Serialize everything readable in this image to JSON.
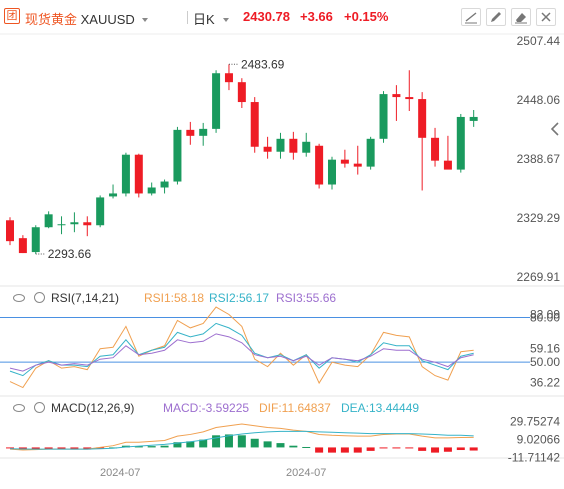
{
  "header": {
    "logo_text": "团",
    "instrument_name": "现货黄金",
    "symbol": "XAUUSD",
    "period": "日K",
    "last": "2430.78",
    "change": "+3.66",
    "change_pct": "+0.15%",
    "tools": [
      "draw-line-icon",
      "pencil-icon",
      "eraser-icon",
      "expand-icon",
      "close-icon"
    ]
  },
  "colors": {
    "up": "#1a9a5e",
    "down": "#ee1c25",
    "rsi1": "#f0a050",
    "rsi2": "#36b3c8",
    "rsi3": "#9d6fcf",
    "diff": "#f0a050",
    "dea": "#36b3c8",
    "level": "#4a90e2"
  },
  "chart_data": [
    {
      "type": "candlestick",
      "yaxis_ticks": [
        "2507.44",
        "2448.06",
        "2388.67",
        "2329.29",
        "2269.91"
      ],
      "ylim": [
        2269.91,
        2507.44
      ],
      "annotations": {
        "high": "2483.69",
        "low": "2293.66"
      },
      "candles": [
        {
          "o": 2327,
          "h": 2330,
          "l": 2302,
          "c": 2306
        },
        {
          "o": 2309,
          "h": 2312,
          "l": 2294,
          "c": 2294
        },
        {
          "o": 2295,
          "h": 2322,
          "l": 2293,
          "c": 2320
        },
        {
          "o": 2320,
          "h": 2336,
          "l": 2319,
          "c": 2333
        },
        {
          "o": 2323,
          "h": 2331,
          "l": 2313,
          "c": 2323
        },
        {
          "o": 2323,
          "h": 2335,
          "l": 2315,
          "c": 2325
        },
        {
          "o": 2325,
          "h": 2331,
          "l": 2311,
          "c": 2322
        },
        {
          "o": 2322,
          "h": 2352,
          "l": 2320,
          "c": 2350
        },
        {
          "o": 2351,
          "h": 2363,
          "l": 2349,
          "c": 2354
        },
        {
          "o": 2354,
          "h": 2395,
          "l": 2351,
          "c": 2393
        },
        {
          "o": 2393,
          "h": 2394,
          "l": 2350,
          "c": 2354
        },
        {
          "o": 2354,
          "h": 2365,
          "l": 2352,
          "c": 2360
        },
        {
          "o": 2360,
          "h": 2368,
          "l": 2354,
          "c": 2366
        },
        {
          "o": 2366,
          "h": 2421,
          "l": 2363,
          "c": 2418
        },
        {
          "o": 2418,
          "h": 2426,
          "l": 2403,
          "c": 2412
        },
        {
          "o": 2412,
          "h": 2425,
          "l": 2402,
          "c": 2419
        },
        {
          "o": 2419,
          "h": 2478,
          "l": 2415,
          "c": 2475
        },
        {
          "o": 2475,
          "h": 2484,
          "l": 2458,
          "c": 2466
        },
        {
          "o": 2466,
          "h": 2470,
          "l": 2440,
          "c": 2446
        },
        {
          "o": 2446,
          "h": 2451,
          "l": 2395,
          "c": 2401
        },
        {
          "o": 2401,
          "h": 2411,
          "l": 2389,
          "c": 2396
        },
        {
          "o": 2396,
          "h": 2415,
          "l": 2389,
          "c": 2409
        },
        {
          "o": 2409,
          "h": 2416,
          "l": 2388,
          "c": 2395
        },
        {
          "o": 2395,
          "h": 2415,
          "l": 2391,
          "c": 2406
        },
        {
          "o": 2402,
          "h": 2404,
          "l": 2359,
          "c": 2363
        },
        {
          "o": 2363,
          "h": 2391,
          "l": 2358,
          "c": 2388
        },
        {
          "o": 2388,
          "h": 2398,
          "l": 2380,
          "c": 2384
        },
        {
          "o": 2384,
          "h": 2402,
          "l": 2373,
          "c": 2381
        },
        {
          "o": 2381,
          "h": 2411,
          "l": 2378,
          "c": 2409
        },
        {
          "o": 2409,
          "h": 2457,
          "l": 2405,
          "c": 2454
        },
        {
          "o": 2454,
          "h": 2463,
          "l": 2427,
          "c": 2451
        },
        {
          "o": 2451,
          "h": 2478,
          "l": 2437,
          "c": 2449
        },
        {
          "o": 2449,
          "h": 2456,
          "l": 2357,
          "c": 2410
        },
        {
          "o": 2410,
          "h": 2420,
          "l": 2381,
          "c": 2387
        },
        {
          "o": 2387,
          "h": 2412,
          "l": 2382,
          "c": 2378
        },
        {
          "o": 2378,
          "h": 2434,
          "l": 2375,
          "c": 2431
        },
        {
          "o": 2427,
          "h": 2438,
          "l": 2421,
          "c": 2431
        }
      ]
    },
    {
      "type": "line",
      "name": "RSI",
      "params": "RSI(7,14,21)",
      "labels": [
        "RSI1:58.18",
        "RSI2:56.17",
        "RSI3:55.66"
      ],
      "ylim": [
        30,
        85
      ],
      "yaxis_ticks": [
        "80.00",
        "82.09",
        "59.16",
        "50.00",
        "36.22"
      ],
      "levels": [
        80,
        50
      ],
      "series": [
        {
          "name": "RSI1",
          "values": [
            37,
            33,
            46,
            51,
            46,
            47,
            45,
            59,
            60,
            74,
            54,
            58,
            61,
            78,
            73,
            76,
            87,
            82,
            74,
            52,
            47,
            56,
            48,
            55,
            36,
            50,
            48,
            47,
            55,
            70,
            68,
            67,
            47,
            41,
            38,
            57,
            58
          ]
        },
        {
          "name": "RSI2",
          "values": [
            44,
            41,
            48,
            51,
            48,
            48,
            47,
            54,
            55,
            65,
            55,
            58,
            60,
            70,
            67,
            69,
            76,
            73,
            68,
            56,
            53,
            55,
            51,
            55,
            46,
            53,
            52,
            50,
            55,
            63,
            61,
            61,
            51,
            48,
            45,
            54,
            56
          ]
        },
        {
          "name": "RSI3",
          "values": [
            46,
            44,
            48,
            50,
            48,
            49,
            48,
            52,
            53,
            61,
            55,
            56,
            58,
            65,
            63,
            64,
            69,
            67,
            63,
            55,
            53,
            54,
            51,
            54,
            48,
            53,
            52,
            51,
            54,
            59,
            58,
            58,
            52,
            50,
            47,
            53,
            55
          ]
        }
      ]
    },
    {
      "type": "macd",
      "params": "MACD(12,26,9)",
      "labels": [
        "MACD:-3.59225",
        "DIF:11.64837",
        "DEA:13.44449"
      ],
      "ylim": [
        -18,
        34
      ],
      "yaxis_ticks": [
        "29.75274",
        "9.02066",
        "-11.71142"
      ],
      "histogram": [
        -1,
        -3,
        -2.5,
        -2,
        -2,
        -2.5,
        -2.5,
        -1,
        0,
        2,
        1.5,
        1.5,
        2,
        6,
        7,
        9,
        14,
        15,
        14,
        10,
        7,
        5,
        2,
        0.5,
        -6,
        -6,
        -6,
        -6,
        -4,
        -1,
        -0.5,
        -0.5,
        -4,
        -6,
        -5,
        -3,
        -3.6
      ],
      "dif": [
        -2,
        -3,
        -2.5,
        -2,
        -2,
        -2,
        -2,
        0,
        2,
        6,
        6,
        7,
        8,
        13,
        15,
        18,
        23,
        25,
        27,
        25,
        23,
        22,
        20,
        18.5,
        15,
        14,
        13.5,
        13,
        13,
        15,
        15.5,
        15.5,
        13,
        11,
        11,
        11.5,
        11.6
      ],
      "dea": [
        -1.5,
        -1.8,
        -2,
        -2,
        -2,
        -1.9,
        -1.9,
        -1.6,
        -1,
        0.5,
        1.5,
        2.5,
        3.5,
        5,
        6.5,
        8.5,
        11,
        13.5,
        15.5,
        17,
        18,
        18.5,
        18.5,
        18.5,
        18,
        17.5,
        17,
        16.5,
        16,
        16,
        16,
        16,
        15.5,
        15,
        14,
        14,
        13.4
      ]
    }
  ],
  "time_axis": [
    "2024-07",
    "2024-07"
  ]
}
